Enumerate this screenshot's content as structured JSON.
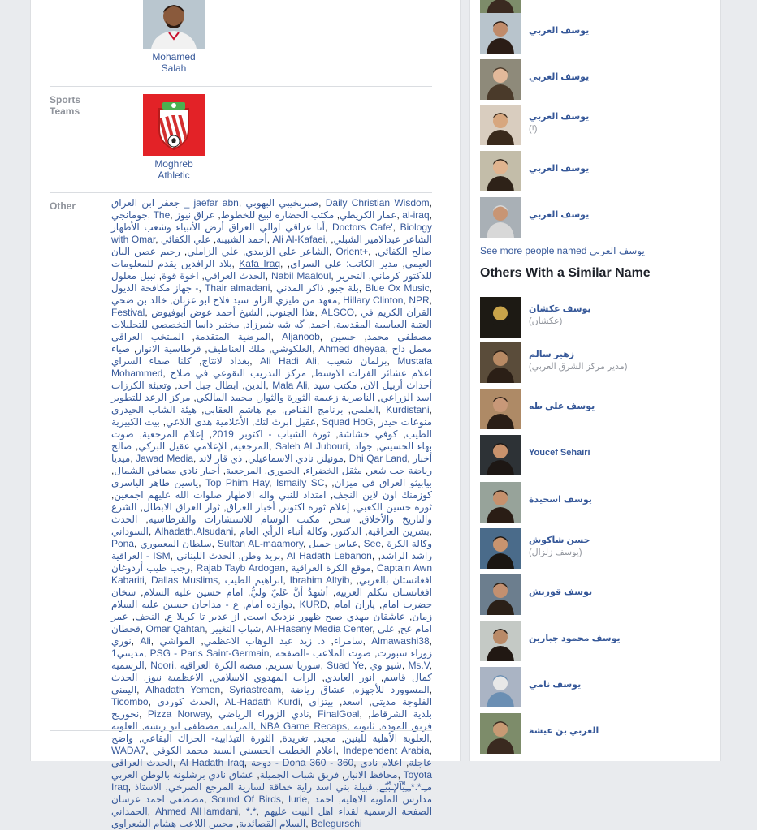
{
  "profile_rows": {
    "athletes_tile": {
      "caption": "Mohamed Salah"
    },
    "sports_teams_label": "Sports Teams",
    "sports_teams_tile": {
      "caption": "Moghreb Athletic"
    },
    "other_label": "Other"
  },
  "other_pages": [
    "جعفر ابن العراق _ jaefar abn",
    "صبربخيبي البهوبي",
    "Daily Christian Wisdom",
    "جومانجي",
    "The",
    "عمار الكريطي",
    "مكتب الحضاره لبيع للخطوط",
    "عراق نيوز",
    "al-iraq",
    "أنا عراقي اوالي العراق أرض الأنبياء وشعب الأطهار",
    "Doctors Cafe'",
    "Biology with Omar",
    "أحمد الشبيبة",
    "علي الكفائي",
    "Ali Al-Kafaei",
    "الشاعر عبدالامير الشبلي",
    "الشاعر علي الزبيدي",
    "علي الزاملي",
    "رجيم عصن البان",
    "Orient+",
    "صالح الكفائي",
    "بلاد الرافدين يقدم للمعلومات",
    "Kafa Iraq",
    "العيمي",
    "مدير الكاتب: علي السراي",
    "الحدث العراقي",
    "اخوة قوة",
    "نبيل معلول",
    "Nabil Maaloul",
    "للدكتور كرماني",
    "التحرير - جهاز مكافحة الذيول",
    "Thair almadani",
    "بلة جبو",
    "ذاكر المدني",
    "Blue Ox Music",
    "معهد من طيزي الزاو",
    "سيد فلاح ابو عزبان",
    "خالد بن ضحي",
    "Hillary Clinton",
    "NPR",
    "Festival",
    "هذا الجنوب",
    "الشيخ أحمد عوض أبوفيوض",
    "ALSCO",
    "القرآن الكريم في العتبة العباسية المقدسة",
    "احمد",
    "گه شه شيرزاد",
    "مختبر داسا التخصصي للتحليلات المرضية المتقدمة",
    "المنتخب العراقي",
    "Aljanoob",
    "مصطفى محمد",
    "حسين العلكوشي",
    "ملك العناطيف",
    "قرطاسية الانوار",
    "صياء",
    "Ahmed dheyaa",
    "معمل داج بغداد لانتاج",
    "كلنا صفاء السراي",
    "Ali Hadi Ali",
    "برلمان شعيب",
    "Mustafa Mohammed",
    "اعلام عشائر الفرات الاوسط",
    "مركز التدريب التقوعي في صلاح الدين",
    "ابطال جبل احد",
    "وتعبئة الكرزات",
    "Mala Ali",
    "أحداث أربيل الآن",
    "مكتب سيد اسد الزراعي",
    "الناصرية زعيمة الثورة والثوار",
    "محمد المالكي",
    "مركز الرعد للتطوير العلمي",
    "برنامج القناص",
    "مع هاشم العقابي",
    "هيئة الشاب الحيدري",
    "Kurdistani",
    "عقيل ابرث لتك",
    "الأعلامية هدى اللاعي",
    "بيت الكبيرية",
    "Squad HoG",
    "منوعات حيدر الطيب",
    "كوفي خشاشة",
    "ثورة الشباب - اكتوبر 2019",
    "إعلام المرجعية",
    "صوت المرجعية",
    "الإعلامي عقيل البركي",
    "صالح",
    "Saleh Al Jubouri",
    "بهاء الحسيني",
    "جواد ميديا",
    "Jawad Media",
    "مونيلز",
    "نادي الاسماعيلي",
    "ذي قار لاند",
    "Dhi Qar Land",
    "أخبار رياضة حب شعر",
    "مثقل الخضراء",
    "الجبوري",
    "المرجعية",
    "أخبار نادي مصافي الشمال",
    "ياسين طاهر الياسري",
    "Top Phim Hay",
    "Ismaily SC",
    "بيابيثو العراق في ميزان",
    "كوزمنك اون لاين النجف",
    "امتداد للنبي واله الاطهار صلوات الله عليهم اجمعين",
    "ثوره حسين الكعبي",
    "إعلام ثوره اكتوبر",
    "أخبار العراق",
    "ثوار العراق الابطال",
    "الشرع والتاريخ والأخلاق",
    "سحر",
    "مكتب الوسام للاستشارات والقرطاسية",
    "الحدث السوداني",
    "Alhadath.Alsudani",
    "بشرين العراقية",
    "الدكتور",
    "وكالة أنباء الرأي العام",
    "Pona",
    "سلطان المعموري",
    "Sultan AL-maamory",
    "عباس جميل",
    "See",
    "وكالة الكرة العراقية - ISM",
    "بريد وطن",
    "الحدث اللبناني",
    "Al Hadath Lebanon",
    "راشد الراشد",
    "رجب طيب أردوغان",
    "Rajab Tayb Ardogan",
    "موقع الكرة العراقية",
    "Captain Awn Kabariti",
    "Dallas Muslims",
    "ابراهيم الطيب",
    "Ibrahim Altyib",
    "افغانستان بالعربي",
    "افغانستان تتكلم العربية",
    "أشهدُ أنَّ عَليّ وليُّ",
    "امام حسين عليه السلام",
    "سخان دوازده امام",
    "ع - مداحان حسين عليه السلام",
    "KURD",
    "حضرت امام",
    "پاران امام زمان",
    "عاشقان مهدي صبح ظهور نزديک است",
    "از عدير تا کربلا ع",
    "النجف",
    "عمر قحطان",
    "Omar Qahtan",
    "شباب التغيير",
    "Al-Hasany Media Center",
    "امام عج",
    "علي نوري",
    "Ali",
    "سامراء",
    "د. زيد عبد الوهاب الاعظمي",
    "المواشي",
    "Almawashi38",
    "مدينتي1",
    "PSG - Paris Saint-Germain",
    "زوراء سبورت",
    "صوت الملاعب -الصفحة الرسمية",
    "Noori",
    "سوريا ستريم",
    "منصة الكرة العراقية",
    "Suad Ye",
    "شيو وي",
    "Ms.V",
    "كمال قاسم",
    "انور العابدي",
    "الراب المهدوي الاسلامي",
    "الاعظمية نيوز",
    "الحدث اليمني",
    "Alhadath Yemen",
    "Syriastream",
    "المسوورد للأجهزه",
    "عشاق رياضة",
    "Ticombo",
    "الحدث كوردى",
    "AL-Hadath Kurdi",
    "الفلوجة مديتي",
    "اسعد",
    "بيتزاى نحوريح",
    "Pizza Norway",
    "نادي الزوراء الرياضي",
    "FinalGoal",
    "بلدية الشرقاط",
    "المزلية",
    "مصطفى ابو ريشة",
    "العلوية",
    "NBA Game Recaps",
    "فريق الموده",
    "ثانوية العلوية الأهلية للبنين",
    "مجيد",
    "تغريدة",
    "الثورة التيذابية- الحراك البقاعي",
    "واضح",
    "WADA7",
    "اعلام الخطيب الحسيني السيد محمد الكوفي",
    "Independent Arabia",
    "الحدث العراقي",
    "Al Hadath Iraq",
    "دوحة - Doha 360 - 360",
    "عاجلة",
    "اعلام نادي محافظ الانبار",
    "فريق شباب الجميلة",
    "عشاق نادي برشلونه بالوطن العربي",
    "Toyota Iraq",
    "مـِـ*.*ـِـِيِّْآلإـبِّيّے",
    "قبيلة بني اسد راية خفاقة لسارية المرجع الصرخي",
    "الاستاذ مصطفى احمد عرسان",
    "Sound Of Birds",
    "Iurie",
    "مدارس الملويه الاهلية",
    "احمد الحمداني",
    "Ahmed AlHamdani",
    "*.*",
    "الصفحة الرسمية لقداء اهل البيت عليهم السلام القصائدية",
    "محبين اللاعب هشام الشعراوي",
    "Belegurschi"
  ],
  "sidebar": {
    "people": [
      {
        "name": "يوسف العربي",
        "sub": ""
      },
      {
        "name": "يوسف العربي",
        "sub": ""
      },
      {
        "name": "يوسف العربي",
        "sub": "(!)"
      },
      {
        "name": "يوسف العربي",
        "sub": ""
      },
      {
        "name": "يوسف العربي",
        "sub": ""
      }
    ],
    "see_more": "See more people named يوسف العربي",
    "similar_title": "Others With a Similar Name",
    "similar": [
      {
        "name": "يوسف عكشان",
        "sub": "(عكشان)"
      },
      {
        "name": "زهير سالم",
        "sub": "(مدير مركز الشرق العربي)"
      },
      {
        "name": "يوسف علي طه",
        "sub": ""
      },
      {
        "name": "Youcef Sehairi",
        "sub": ""
      },
      {
        "name": "يوسف اسحيدة",
        "sub": ""
      },
      {
        "name": "حسن شاكوش",
        "sub": "(يوسف زلزال)"
      },
      {
        "name": "يوسف قوريش",
        "sub": ""
      },
      {
        "name": "يوسف محمود جبارين",
        "sub": ""
      },
      {
        "name": "يوسف نامي",
        "sub": ""
      },
      {
        "name": "العربي بن عيشة",
        "sub": ""
      }
    ]
  }
}
